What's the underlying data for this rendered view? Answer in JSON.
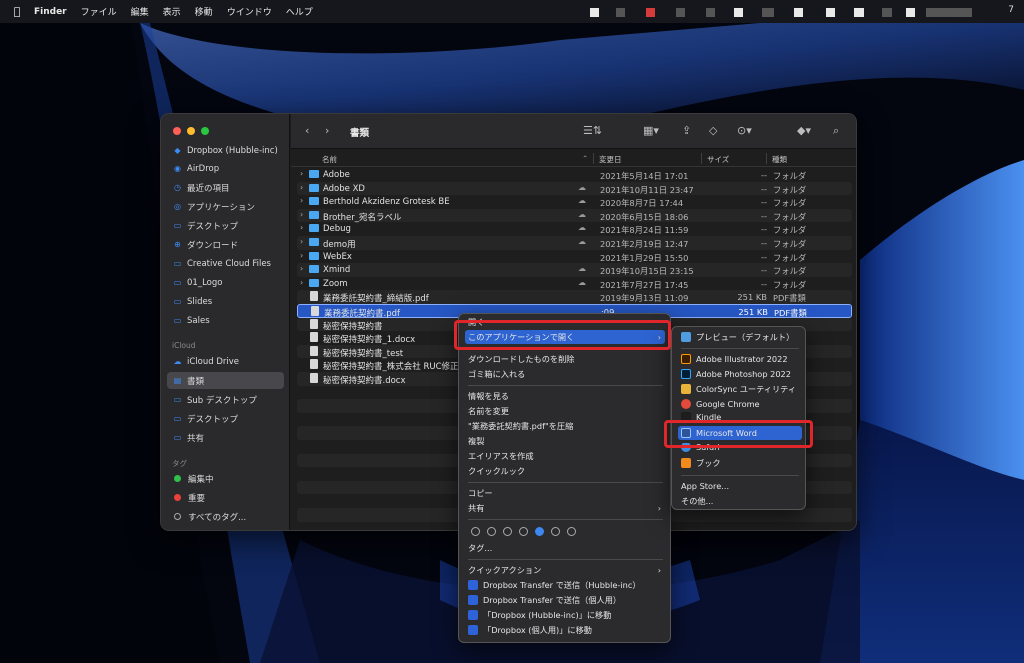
{
  "menubar": {
    "app": "Finder",
    "items": [
      "ファイル",
      "編集",
      "表示",
      "移動",
      "ウインドウ",
      "ヘルプ"
    ],
    "status_number": "7"
  },
  "sidebar": {
    "favorites": [
      "Dropbox (Hubble-inc)",
      "AirDrop",
      "最近の項目",
      "アプリケーション",
      "デスクトップ",
      "ダウンロード",
      "Creative Cloud Files",
      "01_Logo",
      "Slides",
      "Sales"
    ],
    "icloud_header": "iCloud",
    "icloud": [
      "iCloud Drive",
      "書類",
      "Sub デスクトップ",
      "デスクトップ",
      "共有"
    ],
    "tags_header": "タグ",
    "tags": [
      {
        "label": "編集中",
        "color": "#2fc14b"
      },
      {
        "label": "重要",
        "color": "#e8413c"
      },
      {
        "label": "すべてのタグ...",
        "color": ""
      }
    ]
  },
  "toolbar": {
    "title": "書類"
  },
  "columns": {
    "name": "名前",
    "date": "変更日",
    "size": "サイズ",
    "kind": "種類"
  },
  "files": [
    {
      "name": "Adobe",
      "date": "2021年5月14日 17:01",
      "size": "--",
      "kind": "フォルダ",
      "type": "folder",
      "cloud": false
    },
    {
      "name": "Adobe XD",
      "date": "2021年10月11日 23:47",
      "size": "--",
      "kind": "フォルダ",
      "type": "folder",
      "cloud": true
    },
    {
      "name": "Berthold Akzidenz Grotesk BE",
      "date": "2020年8月7日 17:44",
      "size": "--",
      "kind": "フォルダ",
      "type": "folder",
      "cloud": true
    },
    {
      "name": "Brother_宛名ラベル",
      "date": "2020年6月15日 18:06",
      "size": "--",
      "kind": "フォルダ",
      "type": "folder",
      "cloud": true
    },
    {
      "name": "Debug",
      "date": "2021年8月24日 11:59",
      "size": "--",
      "kind": "フォルダ",
      "type": "folder",
      "cloud": true
    },
    {
      "name": "demo用",
      "date": "2021年2月19日 12:47",
      "size": "--",
      "kind": "フォルダ",
      "type": "folder",
      "cloud": true
    },
    {
      "name": "WebEx",
      "date": "2021年1月29日 15:50",
      "size": "--",
      "kind": "フォルダ",
      "type": "folder",
      "cloud": false
    },
    {
      "name": "Xmind",
      "date": "2019年10月15日 23:15",
      "size": "--",
      "kind": "フォルダ",
      "type": "folder",
      "cloud": true
    },
    {
      "name": "Zoom",
      "date": "2021年7月27日 17:45",
      "size": "--",
      "kind": "フォルダ",
      "type": "folder",
      "cloud": true
    },
    {
      "name": "業務委託契約書_締結版.pdf",
      "date": "2019年9月13日 11:09",
      "size": "251 KB",
      "kind": "PDF書類",
      "type": "file",
      "cloud": false
    },
    {
      "name": "業務委託契約書.pdf",
      "date": ":09",
      "size": "251 KB",
      "kind": "PDF書類",
      "type": "file",
      "cloud": false
    },
    {
      "name": "秘密保持契約書",
      "date": "",
      "size": "",
      "kind": "",
      "type": "file",
      "cloud": false
    },
    {
      "name": "秘密保持契約書_1.docx",
      "date": "",
      "size": "",
      "kind": "(.docx)",
      "type": "file",
      "cloud": false
    },
    {
      "name": "秘密保持契約書_test",
      "date": "",
      "size": "",
      "kind": "",
      "type": "file",
      "cloud": false
    },
    {
      "name": "秘密保持契約書_株式会社 RUC修正版",
      "date": "",
      "size": "",
      "kind": "(.docx)",
      "type": "file",
      "cloud": false
    },
    {
      "name": "秘密保持契約書.docx",
      "date": "",
      "size": "",
      "kind": "(.docx)",
      "type": "file",
      "cloud": false
    }
  ],
  "context_menu": {
    "open": "開く",
    "open_with": "このアプリケーションで開く",
    "g1": [
      "ダウンロードしたものを削除",
      "ゴミ箱に入れる"
    ],
    "g2": [
      "情報を見る",
      "名前を変更",
      "\"業務委託契約書.pdf\"を圧縮",
      "複製",
      "エイリアスを作成",
      "クイックルック"
    ],
    "copy": "コピー",
    "share": "共有",
    "tags": "タグ...",
    "quick_actions": "クイックアクション",
    "dropbox": [
      "Dropbox Transfer で送信（Hubble-inc）",
      "Dropbox Transfer で送信（個人用）",
      "「Dropbox (Hubble-inc)」に移動",
      "「Dropbox (個人用)」に移動"
    ]
  },
  "submenu": {
    "default_app": "プレビュー（デフォルト）",
    "apps": [
      "Adobe Illustrator 2022",
      "Adobe Photoshop 2022",
      "ColorSync ユーティリティ",
      "Google Chrome",
      "Kindle",
      "Microsoft Word",
      "Safari",
      "ブック"
    ],
    "app_store": "App Store...",
    "other": "その他..."
  },
  "colors": {
    "accent": "#2e64d2",
    "highlight": "#e0262a"
  }
}
